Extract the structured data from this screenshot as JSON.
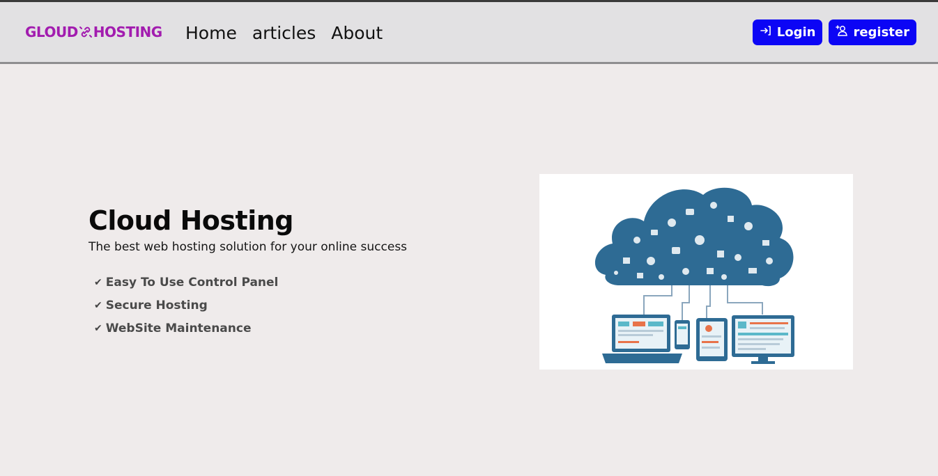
{
  "brand": {
    "left": "GLOUD",
    "right": "HOSTING",
    "color": "#a21caf"
  },
  "nav": {
    "links": [
      "Home",
      "articles",
      "About"
    ]
  },
  "auth": {
    "login_label": "Login",
    "register_label": "register",
    "button_color": "#0c05f5"
  },
  "hero": {
    "title": "Cloud Hosting",
    "subtitle": "The best web hosting solution for your online success",
    "features": [
      "Easy To Use Control Panel",
      "Secure Hosting",
      "WebSite Maintenance"
    ],
    "check_icon": "check-icon",
    "image": "cloud-network-illustration"
  }
}
